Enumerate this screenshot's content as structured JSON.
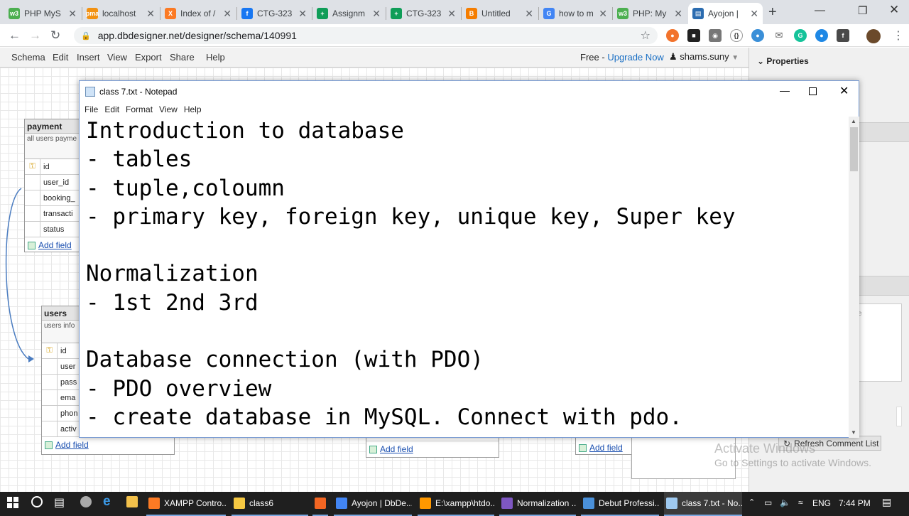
{
  "browser": {
    "tabs": [
      {
        "title": "PHP MyS",
        "favicon": "w3schools-icon",
        "color": "#4caf50",
        "glyph": "w3"
      },
      {
        "title": "localhost",
        "favicon": "phpmyadmin-icon",
        "color": "#f29111",
        "glyph": "pma"
      },
      {
        "title": "Index of /",
        "favicon": "xampp-icon",
        "color": "#fb7a24",
        "glyph": "X"
      },
      {
        "title": "CTG-323",
        "favicon": "facebook-icon",
        "color": "#1877f2",
        "glyph": "f"
      },
      {
        "title": "Assignm",
        "favicon": "google-sheets-icon",
        "color": "#0f9d58",
        "glyph": "+"
      },
      {
        "title": "CTG-323",
        "favicon": "google-sheets-icon",
        "color": "#0f9d58",
        "glyph": "+"
      },
      {
        "title": "Untitled",
        "favicon": "blogger-icon",
        "color": "#f57d00",
        "glyph": "B"
      },
      {
        "title": "how to m",
        "favicon": "google-icon",
        "color": "#4285f4",
        "glyph": "G"
      },
      {
        "title": "PHP: My",
        "favicon": "w3schools-icon",
        "color": "#4caf50",
        "glyph": "w3"
      },
      {
        "title": "Ayojon |",
        "favicon": "dbdesigner-icon",
        "color": "#2b6cb0",
        "glyph": "▤"
      }
    ],
    "new_tab": "+",
    "url": "app.dbdesigner.net/designer/schema/140991"
  },
  "app": {
    "menu": [
      "Schema",
      "Edit",
      "Insert",
      "View",
      "Export",
      "Share",
      "Help"
    ],
    "plan": "Free",
    "plan_sep": "-",
    "upgrade": "Upgrade Now",
    "user": "shams.suny",
    "panel_title": "Properties",
    "refresh_button": "Refresh Comment List",
    "panel_note": "e"
  },
  "tables": {
    "payment": {
      "name": "payment",
      "desc": "all users payme",
      "fields": [
        "id",
        "user_id",
        "booking_",
        "transacti",
        "status"
      ],
      "add": "Add field"
    },
    "users": {
      "name": "users",
      "desc": "users info",
      "fields": [
        "id",
        "user",
        "pass",
        "ema",
        "phon",
        "activ"
      ],
      "add": "Add field"
    },
    "table3": {
      "add": "Add field"
    },
    "table4": {
      "add": "Add field"
    }
  },
  "notepad": {
    "title": "class 7.txt - Notepad",
    "menu": [
      "File",
      "Edit",
      "Format",
      "View",
      "Help"
    ],
    "lines": [
      "Introduction to database",
      "- tables",
      "- tuple,coloumn",
      "- primary key, foreign key, unique key, Super key",
      "",
      "Normalization",
      "- 1st 2nd 3rd",
      "",
      "Database connection (with PDO)",
      "- PDO overview",
      "- create database in MySQL. Connect with pdo."
    ]
  },
  "watermark": {
    "line1": "Activate Windows",
    "line2": "Go to Settings to activate Windows."
  },
  "taskbar": {
    "items": [
      {
        "label": "XAMPP Contro...",
        "color": "#fb7a24"
      },
      {
        "label": "class6",
        "color": "#f5c842"
      },
      {
        "label": "",
        "color": "#f26522"
      },
      {
        "label": "Ayojon | DbDe...",
        "color": "#4285f4"
      },
      {
        "label": "E:\\xampp\\htdo...",
        "color": "#ff9800"
      },
      {
        "label": "Normalization ...",
        "color": "#7e57c2"
      },
      {
        "label": "Debut Professi...",
        "color": "#4a90d9"
      },
      {
        "label": "class 7.txt - No...",
        "color": "#9ec9f0"
      }
    ],
    "lang": "ENG",
    "time": "7:44 PM"
  }
}
